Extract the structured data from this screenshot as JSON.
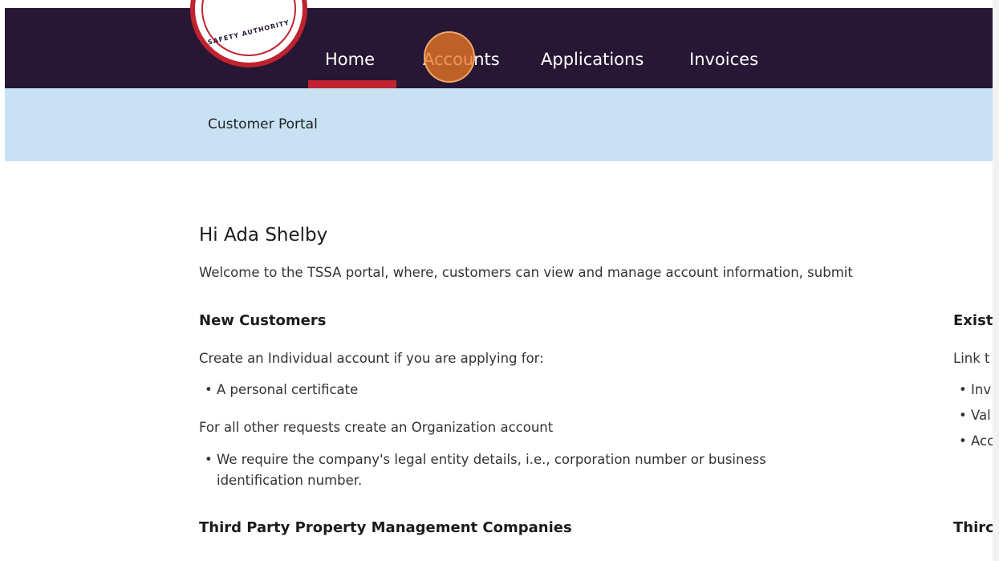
{
  "logo": {
    "text": "SAFETY AUTHORITY"
  },
  "nav": {
    "items": [
      {
        "label": "Home",
        "active": true
      },
      {
        "label": "Accounts",
        "active": false
      },
      {
        "label": "Applications",
        "active": false
      },
      {
        "label": "Invoices",
        "active": false
      }
    ]
  },
  "subheader": {
    "title": "Customer Portal"
  },
  "main": {
    "greeting": "Hi Ada Shelby",
    "welcome": "Welcome to the TSSA portal, where, customers can view and manage account information, submit",
    "new_customers": {
      "heading": "New Customers",
      "intro": "Create an Individual account if you are applying for:",
      "bullets": [
        "A personal certificate"
      ],
      "other": "For all other requests create an Organization account",
      "requirement_line1": "We require the company's legal entity details, i.e., corporation number or business",
      "requirement_line2": "identification number."
    },
    "third_party": {
      "heading": "Third Party Property Management Companies"
    },
    "existing": {
      "heading": "Existi",
      "intro": "Link t",
      "bullets": [
        "Inv",
        "Val",
        "Acc"
      ]
    },
    "third_right": {
      "heading": "Thirc"
    }
  },
  "colors": {
    "navbar": "#271735",
    "accent_red": "#c0232e",
    "subheader": "#c8e2f4",
    "click_marker": "#e97626"
  }
}
